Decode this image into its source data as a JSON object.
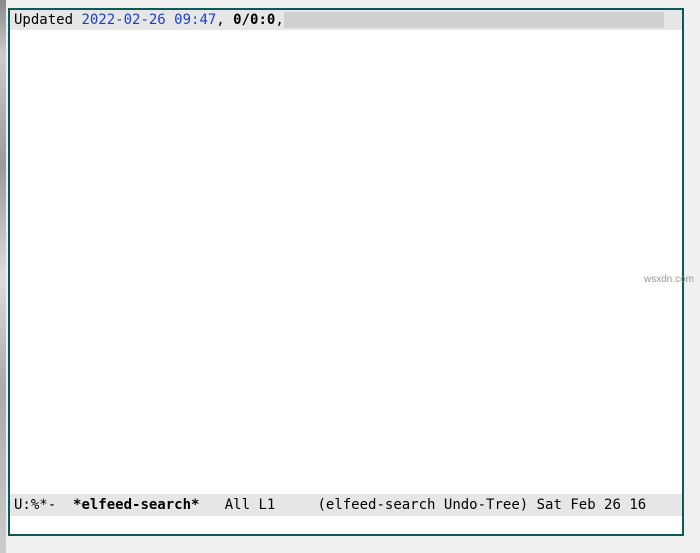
{
  "header": {
    "label": "Updated ",
    "timestamp": "2022-02-26 09:47",
    "separator1": ", ",
    "stats": "0/0:0",
    "separator2": ","
  },
  "modeline": {
    "status": "U:%*-  ",
    "buffer_name": "*elfeed-search*",
    "position": "   All L1     ",
    "modes": "(elfeed-search Undo-Tree) ",
    "datetime": "Sat Feb 26 16"
  },
  "watermark": "wsxdn.com"
}
